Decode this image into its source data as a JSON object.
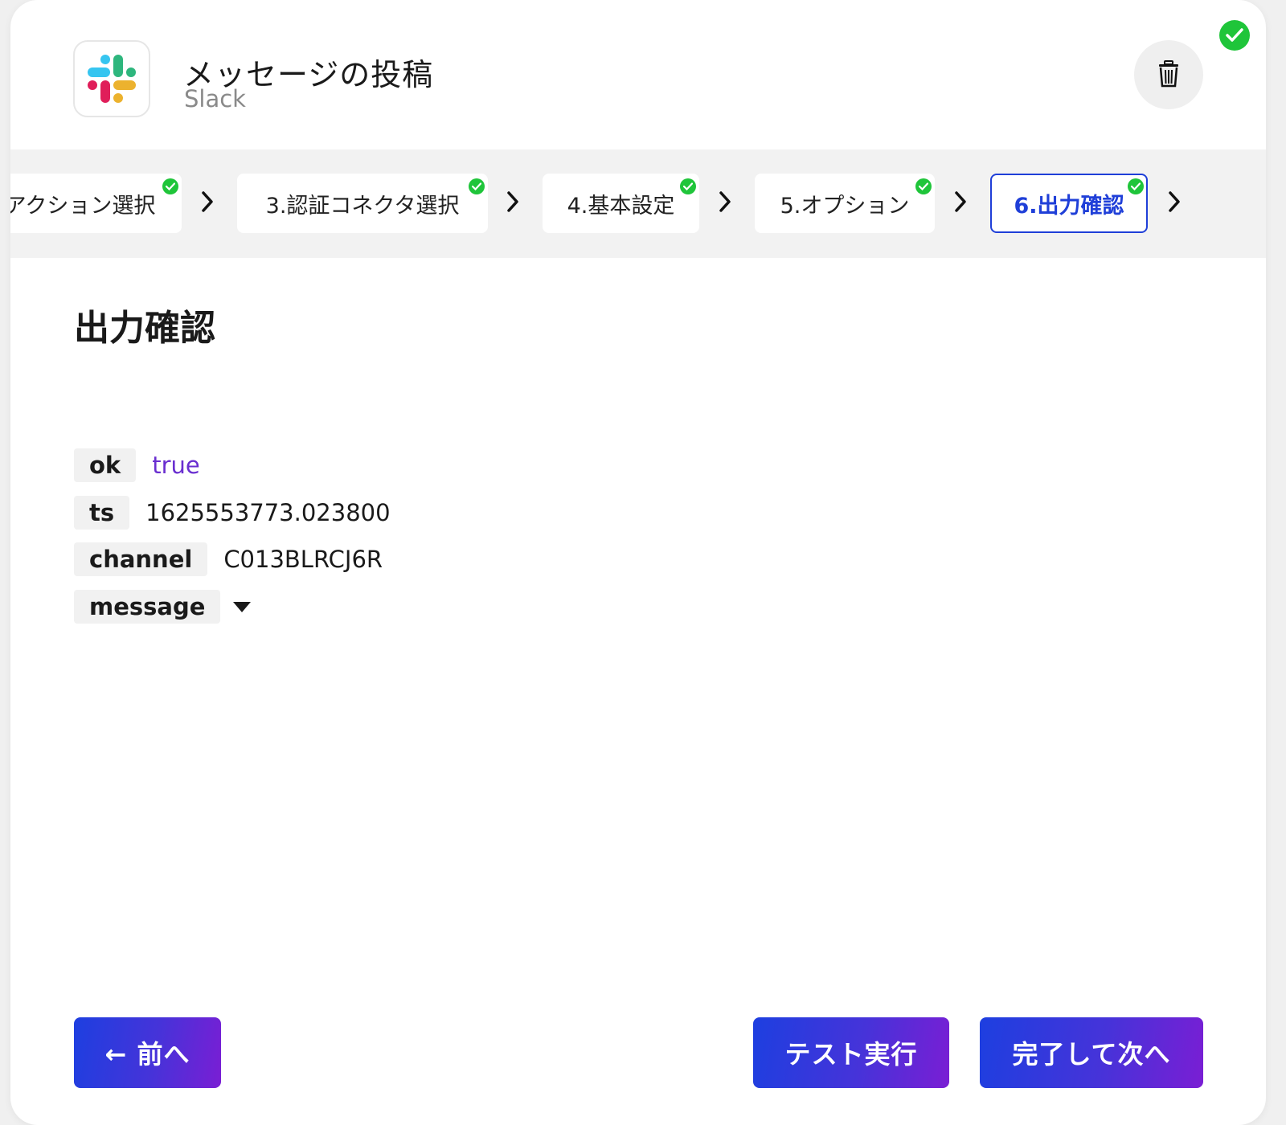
{
  "header": {
    "title": "メッセージの投稿",
    "service": "Slack",
    "app_icon": "slack-logo-icon",
    "delete_icon": "trash-icon",
    "status_icon": "check-circle-icon"
  },
  "steps": [
    {
      "label": "アクション選択",
      "completed": true,
      "active": false
    },
    {
      "label": "3.認証コネクタ選択",
      "completed": true,
      "active": false
    },
    {
      "label": "4.基本設定",
      "completed": true,
      "active": false
    },
    {
      "label": "5.オプション",
      "completed": true,
      "active": false
    },
    {
      "label": "6.出力確認",
      "completed": true,
      "active": true
    }
  ],
  "section": {
    "title": "出力確認"
  },
  "output": [
    {
      "key": "ok",
      "value": "true",
      "type": "boolean"
    },
    {
      "key": "ts",
      "value": "1625553773.023800",
      "type": "string"
    },
    {
      "key": "channel",
      "value": "C013BLRCJ6R",
      "type": "string"
    },
    {
      "key": "message",
      "value": "",
      "type": "object",
      "collapsed": true
    }
  ],
  "buttons": {
    "prev": "← 前へ",
    "test": "テスト実行",
    "next": "完了して次へ"
  },
  "colors": {
    "accent": "#1f3fd8",
    "success": "#1fc53a",
    "boolean": "#6a2fd0",
    "gradient_start": "#1d3fe0",
    "gradient_end": "#7a1ed4"
  }
}
